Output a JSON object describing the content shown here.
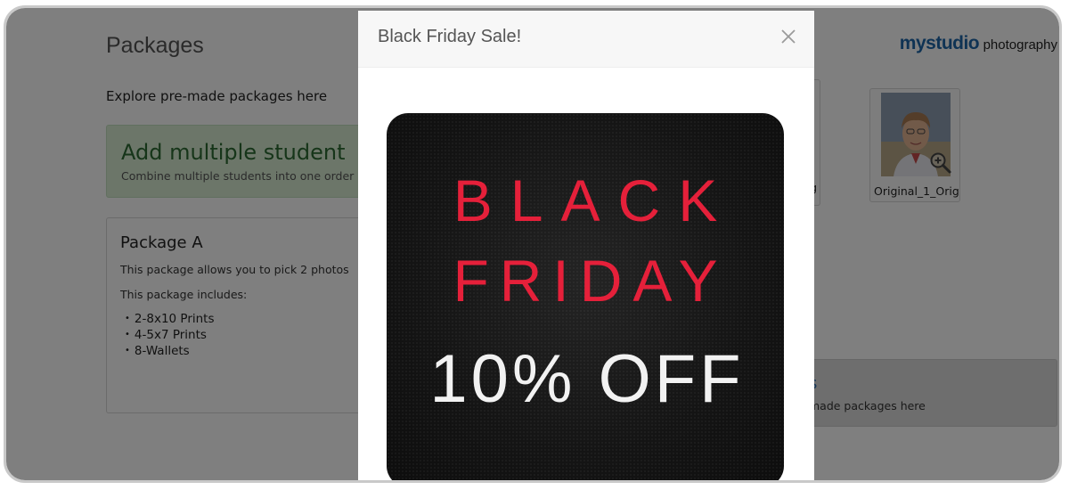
{
  "page": {
    "title": "Packages",
    "brand_my": "mystudio",
    "brand_photo": "photography",
    "intro": "Explore pre-made packages here"
  },
  "multi_student": {
    "title": "Add multiple student",
    "subtitle": "Combine multiple students into one order"
  },
  "package_a": {
    "title": "Package A",
    "description": "This package allows you to pick 2 photos",
    "includes_label": "This package includes:",
    "items": [
      "2-8x10 Prints",
      "4-5x7 Prints",
      "8-Wallets"
    ]
  },
  "photos": [
    {
      "label": "g"
    },
    {
      "label": "Original_1_Orig"
    }
  ],
  "packages_card": {
    "title": "s",
    "subtitle": "made packages here"
  },
  "modal": {
    "title": "Black Friday Sale!",
    "close_icon": "close-icon",
    "promo": {
      "line1": "BLACK",
      "line2": "FRIDAY",
      "line3": "10% OFF"
    }
  },
  "colors": {
    "promo_red": "#e5203a",
    "promo_white": "#f2f2f2",
    "promo_bg": "#141414",
    "brand_blue": "#1f67a8"
  }
}
